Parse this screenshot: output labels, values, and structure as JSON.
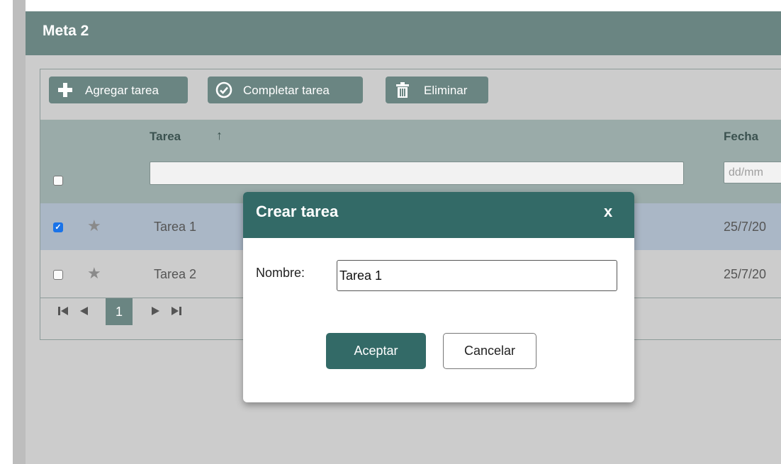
{
  "panel": {
    "title": "Meta 2"
  },
  "toolbar": {
    "add_label": "Agregar tarea",
    "complete_label": "Completar tarea",
    "delete_label": "Eliminar",
    "add_icon": "plus-icon",
    "complete_icon": "check-circle-icon",
    "delete_icon": "trash-icon"
  },
  "grid": {
    "columns": {
      "task": "Tarea",
      "date": "Fecha"
    },
    "sort_indicator": "↑",
    "date_filter_placeholder": "dd/mm",
    "rows": [
      {
        "name": "Tarea 1",
        "date": "25/7/20",
        "checked": true,
        "selected": true
      },
      {
        "name": "Tarea 2",
        "date": "25/7/20",
        "checked": false,
        "selected": false
      }
    ],
    "pager": {
      "first": "⏮",
      "prev": "◀",
      "page": "1",
      "next": "▶",
      "last": "⏭"
    }
  },
  "modal": {
    "title": "Crear tarea",
    "close": "x",
    "name_label": "Nombre:",
    "name_value": "Tarea 1",
    "accept_label": "Aceptar",
    "cancel_label": "Cancelar"
  },
  "colors": {
    "header": "#6a8582",
    "modal_header": "#336a67",
    "selected_row": "#aab7c6",
    "grid_bg": "#cccccc"
  }
}
